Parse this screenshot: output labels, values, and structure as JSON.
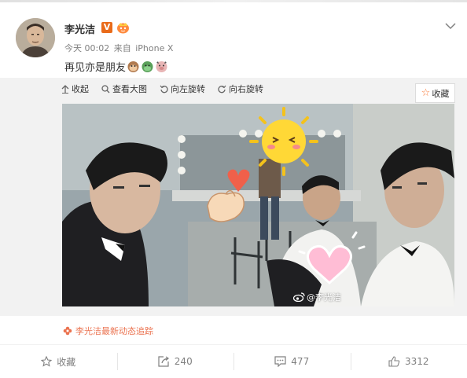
{
  "author": {
    "name": "李光洁",
    "verified_badge": "V",
    "member_icon": "member-crown-icon"
  },
  "meta": {
    "time": "今天 00:02",
    "source_prefix": "来自",
    "source": "iPhone X"
  },
  "post": {
    "text": "再见亦是朋友",
    "emojis": [
      "monkey-face-icon",
      "green-face-icon",
      "pig-face-icon"
    ]
  },
  "media_toolbar": {
    "collapse": "收起",
    "view_large": "查看大图",
    "rotate_left": "向左旋转",
    "rotate_right": "向右旋转"
  },
  "collect_button": "收藏",
  "watermark": "@李光洁",
  "tracking_link": "李光洁最新动态追踪",
  "actions": {
    "favorite": "收藏",
    "repost": "240",
    "comment": "477",
    "like": "3312"
  },
  "colors": {
    "accent": "#eb7350",
    "verified": "#e96b1a",
    "text_gray": "#808080"
  }
}
